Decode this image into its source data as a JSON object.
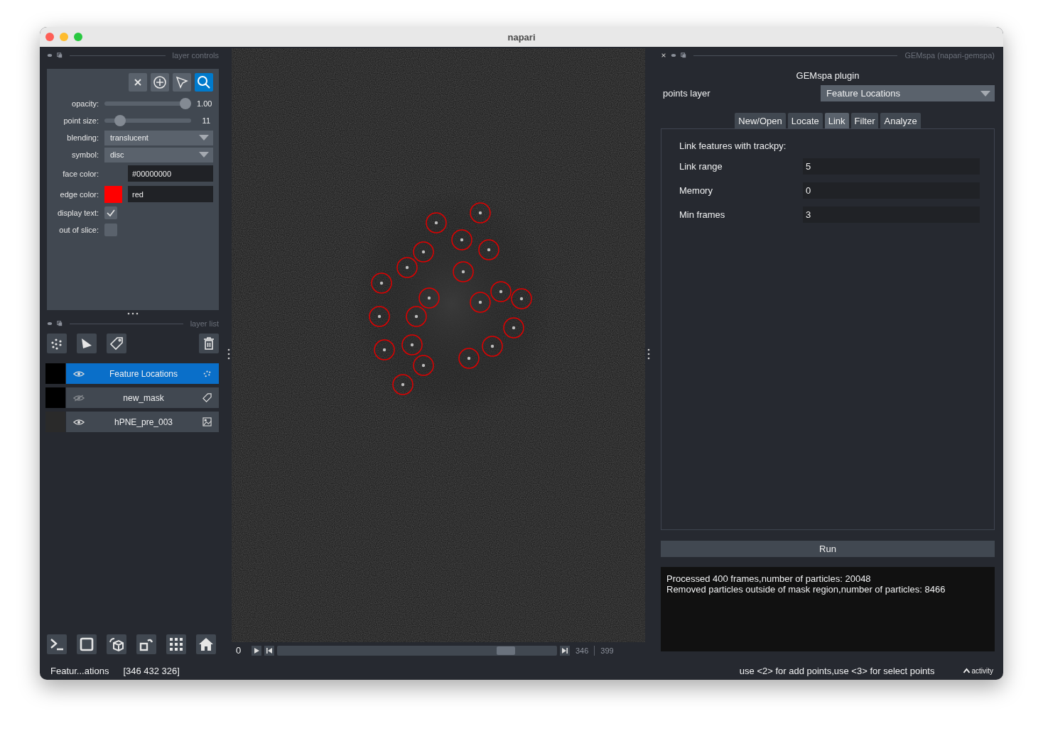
{
  "window": {
    "title": "napari"
  },
  "layer_controls": {
    "title": "layer controls",
    "tools": [
      {
        "kind": "delete",
        "selected": false
      },
      {
        "kind": "add",
        "selected": false
      },
      {
        "kind": "select",
        "selected": false
      },
      {
        "kind": "pan-zoom",
        "selected": true
      }
    ],
    "opacity": {
      "label": "opacity:",
      "level": 1.0,
      "reading": "1.00"
    },
    "point_size": {
      "label": "point size:",
      "level": 0.13,
      "reading": "11"
    },
    "blending": {
      "label": "blending:",
      "value": "translucent"
    },
    "symbol": {
      "label": "symbol:",
      "value": "disc"
    },
    "face_color": {
      "label": "face color:",
      "value": "#00000000"
    },
    "edge_color": {
      "label": "edge color:",
      "value": "red",
      "color": "#ff0000"
    },
    "display_text": {
      "label": "display text:",
      "checked": true
    },
    "out_of_slice": {
      "label": "out of slice:",
      "checked": false
    }
  },
  "layer_list": {
    "title": "layer list",
    "buttons": [
      {
        "kind": "points"
      },
      {
        "kind": "shapes"
      },
      {
        "kind": "labels"
      }
    ],
    "layers": [
      {
        "name": "Feature Locations",
        "kind": "points",
        "selected": true,
        "visible": true
      },
      {
        "name": "new_mask",
        "kind": "labels",
        "selected": false,
        "visible": false
      },
      {
        "name": "hPNE_pre_003",
        "kind": "image",
        "selected": false,
        "visible": true
      }
    ]
  },
  "viewer_buttons": [
    {
      "kind": "console"
    },
    {
      "kind": "ndisplay"
    },
    {
      "kind": "roll"
    },
    {
      "kind": "transpose"
    },
    {
      "kind": "grid"
    },
    {
      "kind": "home"
    }
  ],
  "dims": {
    "frame": "0",
    "level": 0.84,
    "current": "346",
    "total": "399"
  },
  "plugin": {
    "title": "GEMspa (napari-gemspa)",
    "heading": "GEMspa plugin",
    "points_layer": {
      "label": "points layer",
      "value": "Feature Locations"
    },
    "tabs": [
      {
        "label": "New/Open",
        "selected": false
      },
      {
        "label": "Locate",
        "selected": false
      },
      {
        "label": "Link",
        "selected": true
      },
      {
        "label": "Filter",
        "selected": false
      },
      {
        "label": "Analyze",
        "selected": false
      }
    ],
    "panel": {
      "heading": "Link features with trackpy:",
      "fields": [
        {
          "label": "Link range",
          "value": "5"
        },
        {
          "label": "Memory",
          "value": "0"
        },
        {
          "label": "Min frames",
          "value": "3"
        }
      ]
    },
    "run": "Run",
    "output": [
      "Processed 400 frames,number of particles: 20048",
      "Removed particles outside of mask region,number of particles: 8466"
    ]
  },
  "status_bar": {
    "layer": "Featur...ations",
    "coords": "[346 432 326]",
    "hint": "use <2> for add points,use <3> for select points",
    "activity": "activity"
  }
}
